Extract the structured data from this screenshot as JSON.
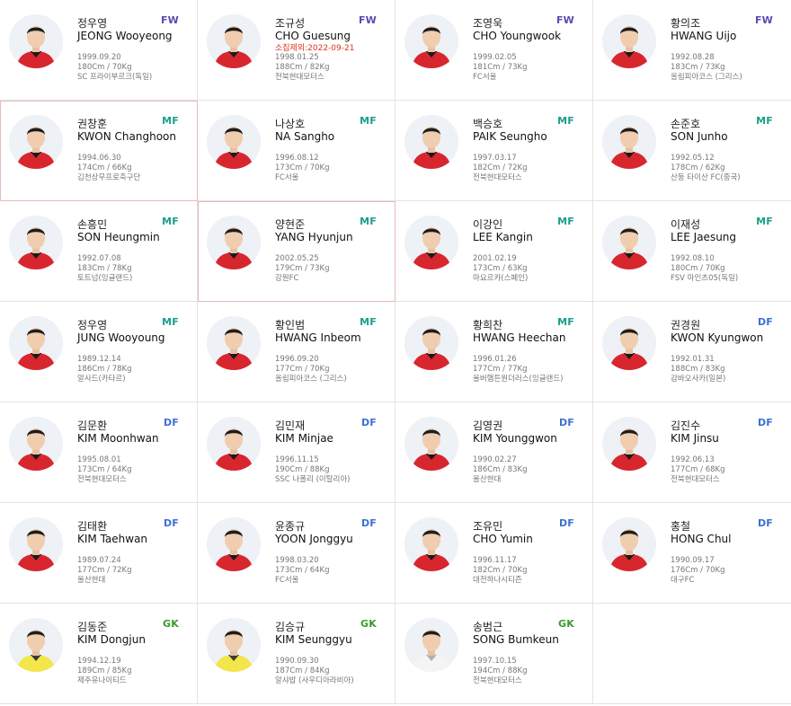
{
  "colors": {
    "fw": "#5a4ab5",
    "mf": "#1a9e8a",
    "df": "#3d6fd3",
    "gk": "#3a9c2e",
    "excluded": "#e0331c"
  },
  "players": [
    {
      "pos": "FW",
      "kor": "정우영",
      "eng": "JEONG Wooyeong",
      "birth": "1999.09.20",
      "body": "180Cm / 70Kg",
      "club": "SC 프라이부르크(독일)",
      "note": "",
      "kit": "red"
    },
    {
      "pos": "FW",
      "kor": "조규성",
      "eng": "CHO Guesung",
      "birth": "1998.01.25",
      "body": "188Cm / 82Kg",
      "club": "전북현대모터스",
      "note": "소집제외:2022-09-21",
      "kit": "red"
    },
    {
      "pos": "FW",
      "kor": "조영욱",
      "eng": "CHO Youngwook",
      "birth": "1999.02.05",
      "body": "181Cm / 73Kg",
      "club": "FC서울",
      "note": "",
      "kit": "red"
    },
    {
      "pos": "FW",
      "kor": "황의조",
      "eng": "HWANG Uijo",
      "birth": "1992.08.28",
      "body": "183Cm / 73Kg",
      "club": "올림피아코스 (그리스)",
      "note": "",
      "kit": "red"
    },
    {
      "pos": "MF",
      "kor": "권창훈",
      "eng": "KWON Changhoon",
      "birth": "1994.06.30",
      "body": "174Cm / 66Kg",
      "club": "김천상무프로축구단",
      "note": "",
      "kit": "red"
    },
    {
      "pos": "MF",
      "kor": "나상호",
      "eng": "NA Sangho",
      "birth": "1996.08.12",
      "body": "173Cm / 70Kg",
      "club": "FC서울",
      "note": "",
      "kit": "red"
    },
    {
      "pos": "MF",
      "kor": "백승호",
      "eng": "PAIK Seungho",
      "birth": "1997.03.17",
      "body": "182Cm / 72Kg",
      "club": "전북현대모터스",
      "note": "",
      "kit": "red"
    },
    {
      "pos": "MF",
      "kor": "손준호",
      "eng": "SON Junho",
      "birth": "1992.05.12",
      "body": "178Cm / 62Kg",
      "club": "산둥 타이산 FC(중국)",
      "note": "",
      "kit": "red"
    },
    {
      "pos": "MF",
      "kor": "손흥민",
      "eng": "SON Heungmin",
      "birth": "1992.07.08",
      "body": "183Cm / 78Kg",
      "club": "토트넘(잉글랜드)",
      "note": "",
      "kit": "red"
    },
    {
      "pos": "MF",
      "kor": "양현준",
      "eng": "YANG Hyunjun",
      "birth": "2002.05.25",
      "body": "179Cm / 73Kg",
      "club": "강원FC",
      "note": "",
      "kit": "red"
    },
    {
      "pos": "MF",
      "kor": "이강인",
      "eng": "LEE Kangin",
      "birth": "2001.02.19",
      "body": "173Cm / 63Kg",
      "club": "마요르카(스페인)",
      "note": "",
      "kit": "red"
    },
    {
      "pos": "MF",
      "kor": "이재성",
      "eng": "LEE Jaesung",
      "birth": "1992.08.10",
      "body": "180Cm / 70Kg",
      "club": "FSV 마인츠05(독일)",
      "note": "",
      "kit": "red"
    },
    {
      "pos": "MF",
      "kor": "정우영",
      "eng": "JUNG Wooyoung",
      "birth": "1989.12.14",
      "body": "186Cm / 78Kg",
      "club": "알사드(카타르)",
      "note": "",
      "kit": "red"
    },
    {
      "pos": "MF",
      "kor": "황인범",
      "eng": "HWANG Inbeom",
      "birth": "1996.09.20",
      "body": "177Cm / 70Kg",
      "club": "올림피아코스 (그리스)",
      "note": "",
      "kit": "red"
    },
    {
      "pos": "MF",
      "kor": "황희찬",
      "eng": "HWANG Heechan",
      "birth": "1996.01.26",
      "body": "177Cm / 77Kg",
      "club": "울버햄튼원더러스(잉글랜드)",
      "note": "",
      "kit": "red"
    },
    {
      "pos": "DF",
      "kor": "권경원",
      "eng": "KWON Kyungwon",
      "birth": "1992.01.31",
      "body": "188Cm / 83Kg",
      "club": "감바오사카(일본)",
      "note": "",
      "kit": "red"
    },
    {
      "pos": "DF",
      "kor": "김문환",
      "eng": "KIM Moonhwan",
      "birth": "1995.08.01",
      "body": "173Cm / 64Kg",
      "club": "전북현대모터스",
      "note": "",
      "kit": "red"
    },
    {
      "pos": "DF",
      "kor": "김민재",
      "eng": "KIM Minjae",
      "birth": "1996.11.15",
      "body": "190Cm / 88Kg",
      "club": "SSC 나폴리 (이탈리아)",
      "note": "",
      "kit": "red"
    },
    {
      "pos": "DF",
      "kor": "김영권",
      "eng": "KIM Younggwon",
      "birth": "1990.02.27",
      "body": "186Cm / 83Kg",
      "club": "울산현대",
      "note": "",
      "kit": "red"
    },
    {
      "pos": "DF",
      "kor": "김진수",
      "eng": "KIM Jinsu",
      "birth": "1992.06.13",
      "body": "177Cm / 68Kg",
      "club": "전북현대모터스",
      "note": "",
      "kit": "red"
    },
    {
      "pos": "DF",
      "kor": "김태환",
      "eng": "KIM Taehwan",
      "birth": "1989.07.24",
      "body": "177Cm / 72Kg",
      "club": "울산현대",
      "note": "",
      "kit": "red"
    },
    {
      "pos": "DF",
      "kor": "윤종규",
      "eng": "YOON Jonggyu",
      "birth": "1998.03.20",
      "body": "173Cm / 64Kg",
      "club": "FC서울",
      "note": "",
      "kit": "red"
    },
    {
      "pos": "DF",
      "kor": "조유민",
      "eng": "CHO Yumin",
      "birth": "1996.11.17",
      "body": "182Cm / 70Kg",
      "club": "대전하나시티즌",
      "note": "",
      "kit": "red"
    },
    {
      "pos": "DF",
      "kor": "홍철",
      "eng": "HONG Chul",
      "birth": "1990.09.17",
      "body": "176Cm / 70Kg",
      "club": "대구FC",
      "note": "",
      "kit": "red"
    },
    {
      "pos": "GK",
      "kor": "김동준",
      "eng": "KIM Dongjun",
      "birth": "1994.12.19",
      "body": "189Cm / 85Kg",
      "club": "제주유나이티드",
      "note": "",
      "kit": "yellow"
    },
    {
      "pos": "GK",
      "kor": "김승규",
      "eng": "KIM Seunggyu",
      "birth": "1990.09.30",
      "body": "187Cm / 84Kg",
      "club": "알샤밥 (사우디아라비아)",
      "note": "",
      "kit": "yellow"
    },
    {
      "pos": "GK",
      "kor": "송범근",
      "eng": "SONG Bumkeun",
      "birth": "1997.10.15",
      "body": "194Cm / 88Kg",
      "club": "전북현대모터스",
      "note": "",
      "kit": "white"
    }
  ]
}
